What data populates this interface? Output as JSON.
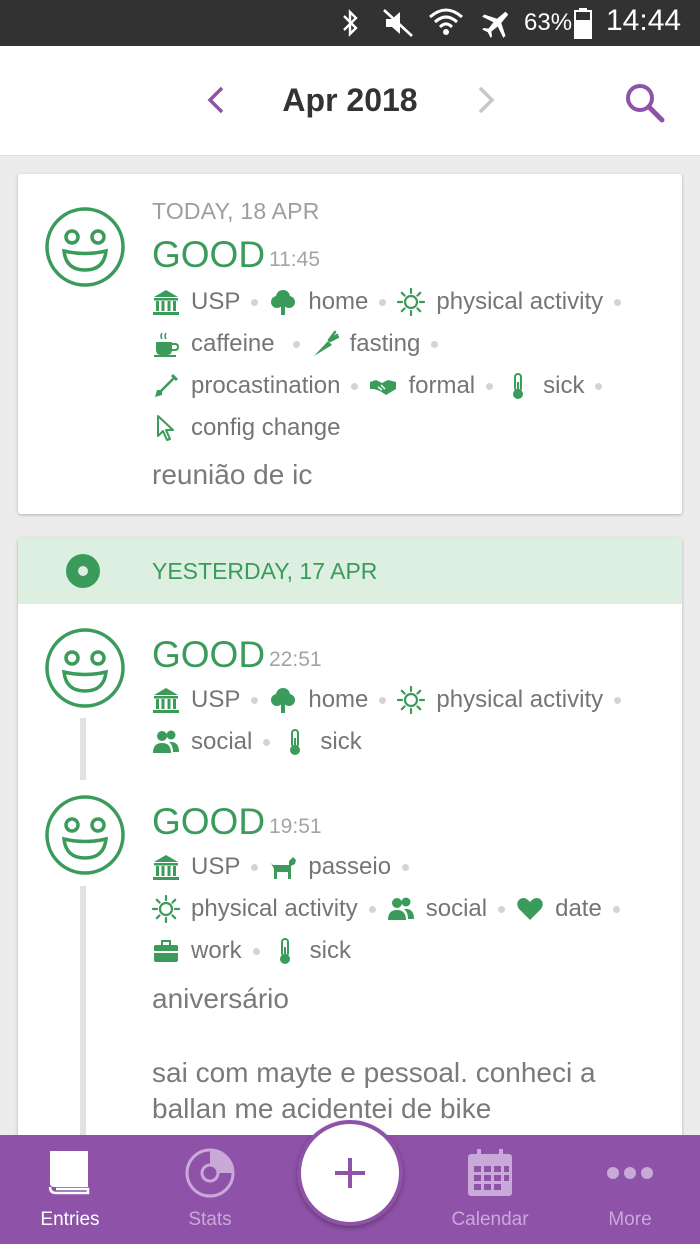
{
  "status_bar": {
    "battery": "63%",
    "time": "14:44"
  },
  "header": {
    "title": "Apr 2018"
  },
  "today": {
    "date_label": "TODAY, 18 APR",
    "entry": {
      "mood": "GOOD",
      "time": "11:45",
      "activities": [
        {
          "label": "USP",
          "icon": "bank-icon"
        },
        {
          "label": "home",
          "icon": "tree-icon"
        },
        {
          "label": "physical activity",
          "icon": "sun-icon"
        },
        {
          "label": "caffeine",
          "icon": "coffee-icon"
        },
        {
          "label": "fasting",
          "icon": "carrot-icon"
        },
        {
          "label": "procastination",
          "icon": "shovel-icon"
        },
        {
          "label": "formal",
          "icon": "handshake-icon"
        },
        {
          "label": "sick",
          "icon": "thermometer-icon"
        },
        {
          "label": "config change",
          "icon": "cursor-icon"
        }
      ],
      "note": "reunião de ic"
    }
  },
  "yesterday": {
    "date_label": "YESTERDAY, 17 APR",
    "entries": [
      {
        "mood": "GOOD",
        "time": "22:51",
        "activities": [
          {
            "label": "USP",
            "icon": "bank-icon"
          },
          {
            "label": "home",
            "icon": "tree-icon"
          },
          {
            "label": "physical activity",
            "icon": "sun-icon"
          },
          {
            "label": "social",
            "icon": "people-icon"
          },
          {
            "label": "sick",
            "icon": "thermometer-icon"
          }
        ]
      },
      {
        "mood": "GOOD",
        "time": "19:51",
        "activities": [
          {
            "label": "USP",
            "icon": "bank-icon"
          },
          {
            "label": "passeio",
            "icon": "dog-icon"
          },
          {
            "label": "physical activity",
            "icon": "sun-icon"
          },
          {
            "label": "social",
            "icon": "people-icon"
          },
          {
            "label": "date",
            "icon": "heart-icon"
          },
          {
            "label": "work",
            "icon": "briefcase-icon"
          },
          {
            "label": "sick",
            "icon": "thermometer-icon"
          }
        ],
        "note_title": "aniversário",
        "note_body": "sai com mayte e pessoal. conheci a ballan me acidentei de bike"
      }
    ]
  },
  "bottom_nav": {
    "items": [
      {
        "label": "Entries",
        "icon": "book-icon",
        "active": true
      },
      {
        "label": "Stats",
        "icon": "chart-icon",
        "active": false
      },
      {
        "label": "Calendar",
        "icon": "calendar-icon",
        "active": false
      },
      {
        "label": "More",
        "icon": "more-icon",
        "active": false
      }
    ],
    "add_icon": "plus-icon"
  },
  "colors": {
    "accent": "#8e52a8",
    "mood_good": "#3b9b5b",
    "day_header_bg": "#dcefe1"
  }
}
